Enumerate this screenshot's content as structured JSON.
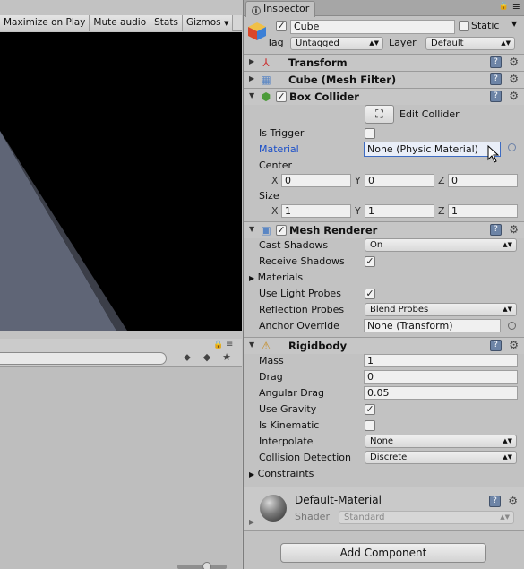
{
  "game_toolbar": {
    "maximize_on_play": "Maximize on Play",
    "mute_audio": "Mute audio",
    "stats": "Stats",
    "gizmos": "Gizmos"
  },
  "inspector": {
    "tab_label": "Inspector",
    "object_name": "Cube",
    "static_label": "Static",
    "tag_label": "Tag",
    "tag_value": "Untagged",
    "layer_label": "Layer",
    "layer_value": "Default"
  },
  "transform": {
    "title": "Transform"
  },
  "mesh_filter": {
    "title": "Cube (Mesh Filter)"
  },
  "box_collider": {
    "title": "Box Collider",
    "edit_collider": "Edit Collider",
    "is_trigger_label": "Is Trigger",
    "material_label": "Material",
    "material_value": "None (Physic Material)",
    "center_label": "Center",
    "size_label": "Size",
    "x_label": "X",
    "y_label": "Y",
    "z_label": "Z",
    "center_x": "0",
    "center_y": "0",
    "center_z": "0",
    "size_x": "1",
    "size_y": "1",
    "size_z": "1"
  },
  "mesh_renderer": {
    "title": "Mesh Renderer",
    "cast_shadows_label": "Cast Shadows",
    "cast_shadows_value": "On",
    "receive_shadows_label": "Receive Shadows",
    "materials_label": "Materials",
    "use_light_probes_label": "Use Light Probes",
    "reflection_probes_label": "Reflection Probes",
    "reflection_probes_value": "Blend Probes",
    "anchor_override_label": "Anchor Override",
    "anchor_override_value": "None (Transform)"
  },
  "rigidbody": {
    "title": "Rigidbody",
    "mass_label": "Mass",
    "mass_value": "1",
    "drag_label": "Drag",
    "drag_value": "0",
    "angular_drag_label": "Angular Drag",
    "angular_drag_value": "0.05",
    "use_gravity_label": "Use Gravity",
    "is_kinematic_label": "Is Kinematic",
    "interpolate_label": "Interpolate",
    "interpolate_value": "None",
    "collision_detection_label": "Collision Detection",
    "collision_detection_value": "Discrete",
    "constraints_label": "Constraints"
  },
  "material_preview": {
    "name": "Default-Material",
    "shader_label": "Shader",
    "shader_value": "Standard"
  },
  "add_component_label": "Add Component"
}
